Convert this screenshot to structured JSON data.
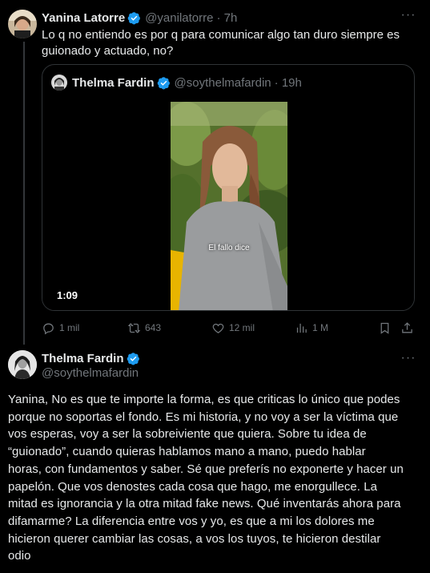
{
  "reply_tweet": {
    "author_name": "Yanina Latorre",
    "author_handle": "@yanilatorre",
    "time": "· 7h",
    "text_line1": "Lo q no entiendo es por q para comunicar algo tan duro siempre es",
    "text_line2": "guionado y actuado, no?",
    "more": "···"
  },
  "quoted_tweet": {
    "author_name": "Thelma Fardin",
    "author_handle": "@soythelmafardin",
    "time": "· 19h",
    "video_duration": "1:09",
    "video_caption": "El fallo dice"
  },
  "actions": {
    "replies": "1 mil",
    "retweets": "643",
    "likes": "12 mil",
    "views": "1 M"
  },
  "main_tweet": {
    "author_name": "Thelma Fardin",
    "author_handle": "@soythelmafardin",
    "more": "···",
    "text_lines": [
      "Yanina, No es que te importe la forma, es que criticas lo único que podes",
      "porque no soportas el fondo. Es mi historia, y no voy a ser la víctima que",
      "vos esperas, voy a ser la sobreiviente que quiera. Sobre tu idea de",
      "“guionado”, cuando quieras hablamos mano a mano, puedo hablar",
      "horas, con fundamentos y saber. Sé que preferís no exponerte y hacer un",
      "papelón. Que vos denostes cada cosa que hago, me enorgullece. La",
      "mitad es ignorancia y la otra mitad fake news. Qué inventarás ahora para",
      "difamarme? La diferencia entre vos y yo, es que a mi los dolores me",
      "hicieron querer cambiar las cosas, a vos los tuyos, te hicieron destilar",
      "odio"
    ]
  },
  "colors": {
    "background": "#000000",
    "text": "#e7e9ea",
    "secondary": "#71767b",
    "border": "#2f3336",
    "verified": "#1d9bf0"
  }
}
